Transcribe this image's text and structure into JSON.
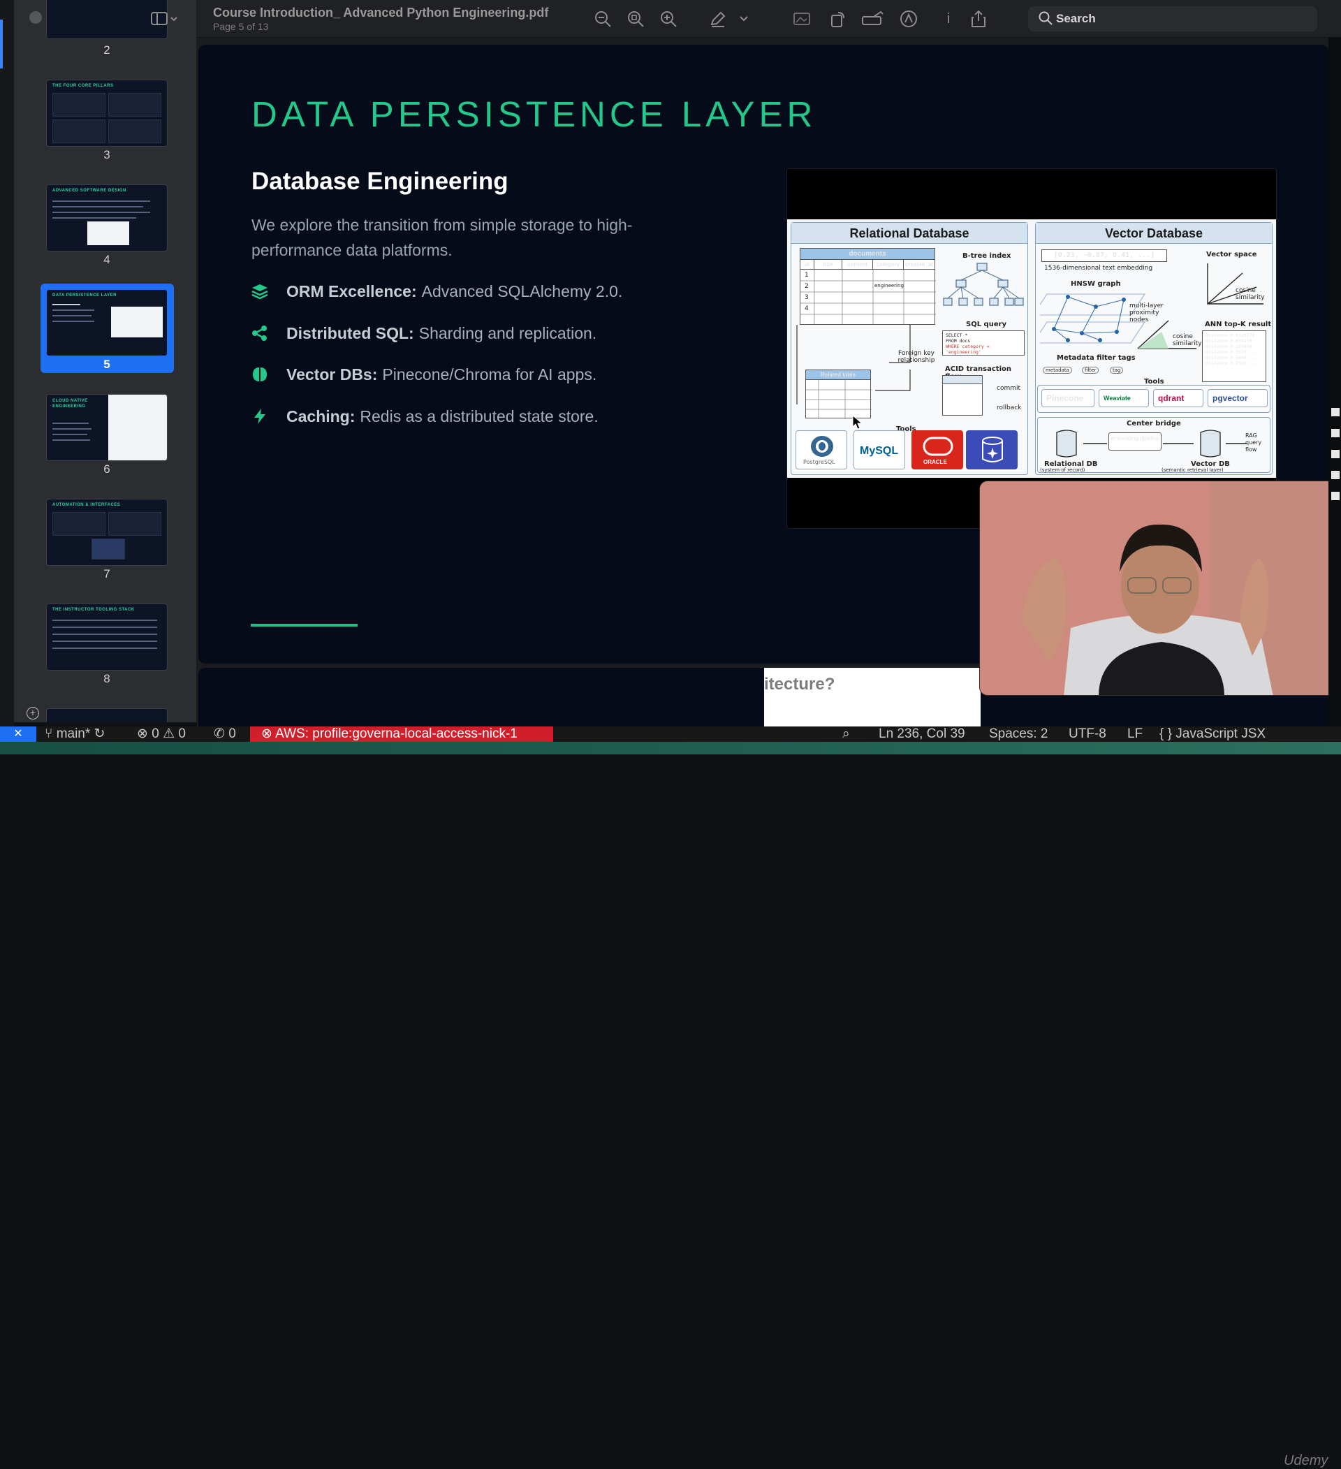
{
  "toolbar": {
    "doc_title": "Course Introduction_ Advanced Python Engineering.pdf",
    "page_indicator": "Page 5 of 13",
    "search_placeholder": "Search",
    "icons": [
      "sidebar-toggle",
      "zoom-out",
      "zoom-fit",
      "zoom-in",
      "markup",
      "more",
      "crop",
      "rotate",
      "highlight",
      "annotate",
      "info",
      "share",
      "search"
    ]
  },
  "sidebar": {
    "pages": [
      {
        "num": "2",
        "title": ""
      },
      {
        "num": "3",
        "title": "THE FOUR CORE PILLARS"
      },
      {
        "num": "4",
        "title": "ADVANCED SOFTWARE DESIGN"
      },
      {
        "num": "5",
        "title": "DATA PERSISTENCE LAYER",
        "selected": true
      },
      {
        "num": "6",
        "title": "CLOUD NATIVE ENGINEERING"
      },
      {
        "num": "7",
        "title": "AUTOMATION & INTERFACES"
      },
      {
        "num": "8",
        "title": "THE INSTRUCTOR TOOLING STACK"
      }
    ]
  },
  "slide": {
    "title": "DATA PERSISTENCE LAYER",
    "subtitle": "Database Engineering",
    "description": "We explore the transition from simple storage to high-performance data platforms.",
    "bullets": [
      {
        "key": "ORM Excellence:",
        "value": "Advanced SQLAlchemy 2.0.",
        "icon": "layers-icon"
      },
      {
        "key": "Distributed SQL:",
        "value": "Sharding and replication.",
        "icon": "share-nodes-icon"
      },
      {
        "key": "Vector DBs:",
        "value": "Pinecone/Chroma for AI apps.",
        "icon": "brain-icon"
      },
      {
        "key": "Caching:",
        "value": "Redis as a distributed state store.",
        "icon": "bolt-icon"
      }
    ],
    "accent_color": "#22c98b"
  },
  "diagram": {
    "relational": {
      "title": "Relational Database",
      "table_name": "documents",
      "columns": [
        "id",
        "title",
        "content",
        "category",
        "created_at"
      ],
      "rows": [
        "1",
        "2",
        "3",
        "4"
      ],
      "cell_highlight": "engineering",
      "btree": "B-tree index",
      "sql_label": "SQL query",
      "sql_text": [
        "SELECT *",
        "FROM docs",
        "WHERE category = 'engineering'"
      ],
      "fk_label": "Foreign key relationship",
      "related_table": "Related table",
      "acid": "ACID transaction flow",
      "commit": "commit",
      "rollback": "rollback",
      "tools_label": "Tools",
      "tools": [
        "PostgreSQL",
        "MySQL",
        "ORACLE",
        "SQL Server"
      ]
    },
    "vector": {
      "title": "Vector Database",
      "embedding": "[0.23, −0.87, 0.41, ...]",
      "embedding_caption": "1536-dimensional text embedding",
      "space_label": "Vector space",
      "cosine_label": "cosine similarity",
      "hnsw": "HNSW graph",
      "hnsw_caption": "multi-layer proximity nodes",
      "ann_title": "ANN top-K result",
      "ann_rows": [
        "distance 0.9326778",
        "distance 0.039458",
        "distance 0.159490",
        "distance 0.3620 ...",
        "distance 0.6688 ...",
        "distance 0.2910 ..."
      ],
      "filter_label": "Metadata filter tags",
      "filter_tags": [
        "metadata",
        "filter",
        "tag"
      ],
      "tools_label": "Tools",
      "tools": [
        "Pinecone",
        "Weaviate",
        "qdrant",
        "pgvector"
      ],
      "bridge_label": "Center bridge",
      "bridge_left": "Relational DB",
      "bridge_left_caption": "(system of record)",
      "bridge_mid": "embedding pipeline",
      "bridge_right": "Vector DB",
      "bridge_right_caption": "(semantic retrieval layer)",
      "bridge_end": "RAG query flow"
    }
  },
  "next_slide": {
    "overlay_text": "itecture?"
  },
  "statusbar": {
    "branch": "main*",
    "errors": "0",
    "warnings": "0",
    "ports": "0",
    "aws_profile": "AWS: profile:governa-local-access-nick-1",
    "cursor": "Ln 236, Col 39",
    "spaces": "Spaces: 2",
    "encoding": "UTF-8",
    "eol": "LF",
    "language": "JavaScript JSX",
    "watermark": "Udemy"
  }
}
